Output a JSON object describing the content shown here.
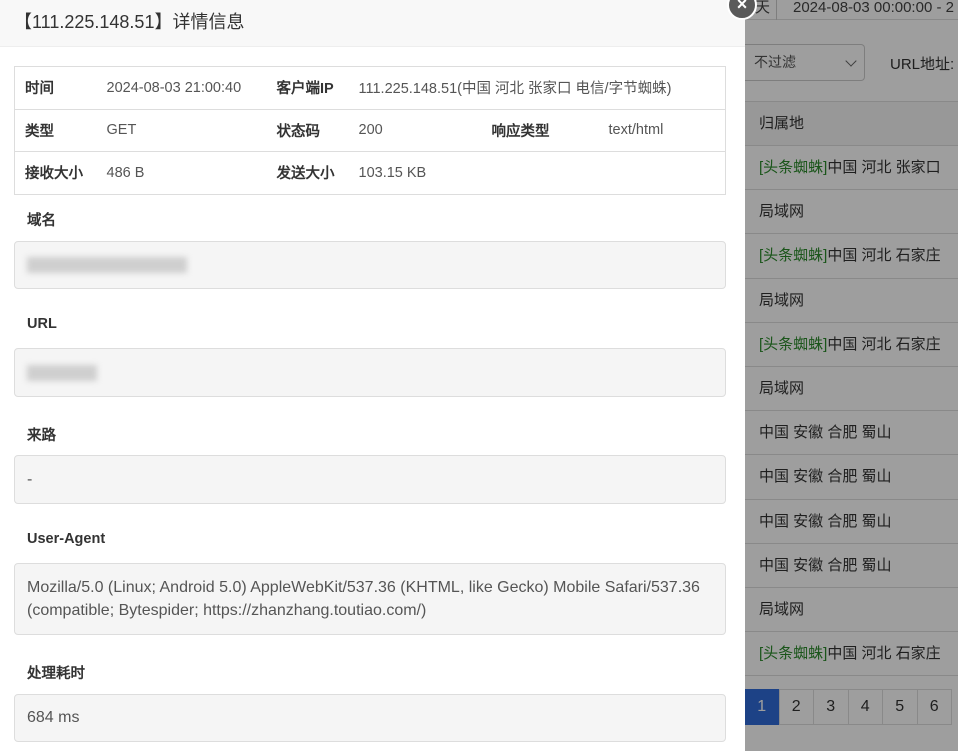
{
  "background": {
    "day_label": "天",
    "date_range": "2024-08-03 00:00:00 - 2",
    "filter_value": "不过滤",
    "url_label": "URL地址:",
    "table_header": "归属地",
    "rows": [
      {
        "tag": "[头条蜘蛛]",
        "text": "中国 河北 张家口"
      },
      {
        "tag": "",
        "text": "局域网"
      },
      {
        "tag": "[头条蜘蛛]",
        "text": "中国 河北 石家庄"
      },
      {
        "tag": "",
        "text": "局域网"
      },
      {
        "tag": "[头条蜘蛛]",
        "text": "中国 河北 石家庄"
      },
      {
        "tag": "",
        "text": "局域网"
      },
      {
        "tag": "",
        "text": "中国 安徽 合肥 蜀山"
      },
      {
        "tag": "",
        "text": "中国 安徽 合肥 蜀山"
      },
      {
        "tag": "",
        "text": "中国 安徽 合肥 蜀山"
      },
      {
        "tag": "",
        "text": "中国 安徽 合肥 蜀山"
      },
      {
        "tag": "",
        "text": "局域网"
      },
      {
        "tag": "[头条蜘蛛]",
        "text": "中国 河北 石家庄"
      }
    ],
    "pages": [
      "1",
      "2",
      "3",
      "4",
      "5",
      "6"
    ],
    "active_page": "1"
  },
  "modal": {
    "title": "【111.225.148.51】详情信息",
    "close_icon": "close-icon",
    "info": {
      "time_label": "时间",
      "time_value": "2024-08-03 21:00:40",
      "client_ip_label": "客户端IP",
      "client_ip_value": "111.225.148.51(中国 河北 张家口 电信/字节蜘蛛)",
      "type_label": "类型",
      "type_value": "GET",
      "status_label": "状态码",
      "status_value": "200",
      "resp_type_label": "响应类型",
      "resp_type_value": "text/html",
      "recv_label": "接收大小",
      "recv_value": "486 B",
      "sent_label": "发送大小",
      "sent_value": "103.15 KB"
    },
    "domain_label": "域名",
    "url_label": "URL",
    "referer_label": "来路",
    "referer_value": "-",
    "ua_label": "User-Agent",
    "ua_value": "Mozilla/5.0 (Linux; Android 5.0) AppleWebKit/537.36 (KHTML, like Gecko) Mobile Safari/537.36 (compatible; Bytespider; https://zhanzhang.toutiao.com/)",
    "time_cost_label": "处理耗时",
    "time_cost_value": "684 ms"
  }
}
